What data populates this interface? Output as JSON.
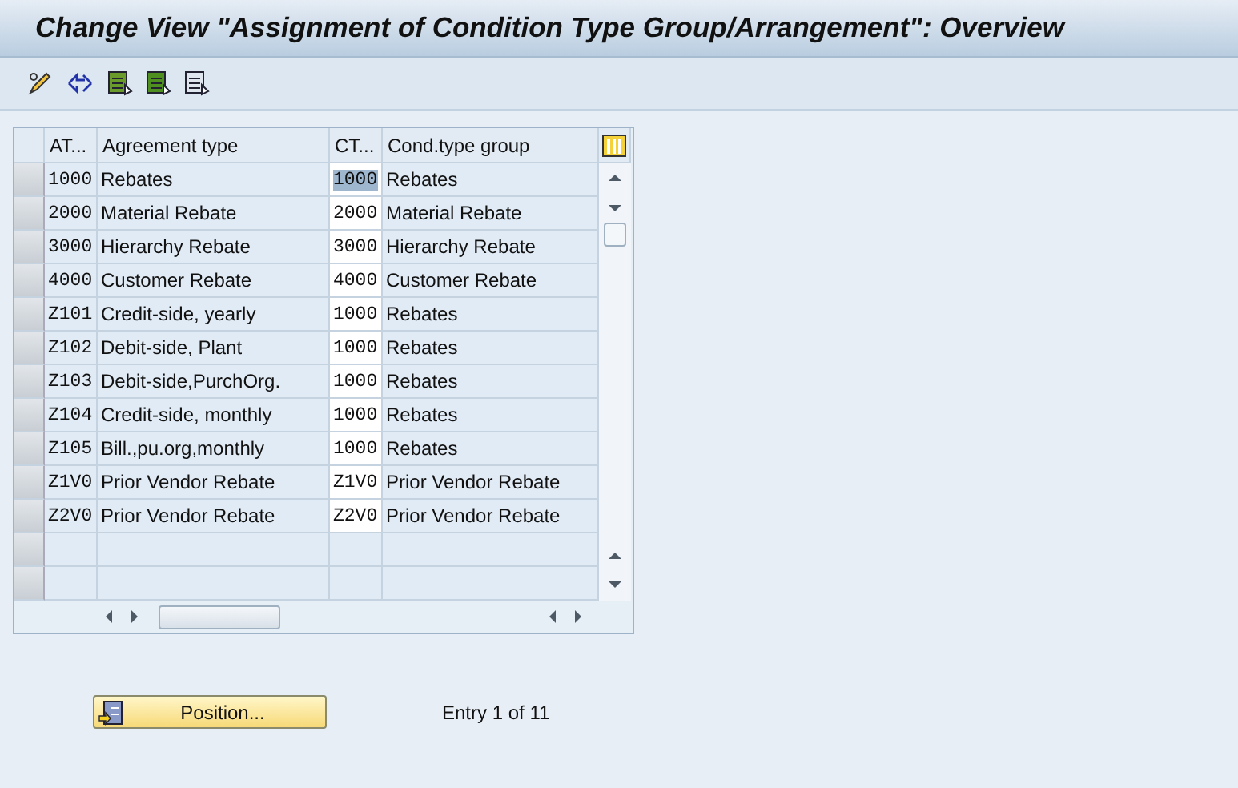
{
  "window": {
    "title": "Change View \"Assignment of Condition Type Group/Arrangement\": Overview"
  },
  "table": {
    "columns": [
      "AT...",
      "Agreement type",
      "CT...",
      "Cond.type group"
    ],
    "rows": [
      {
        "at": "1000",
        "agreement": "Rebates",
        "ct": "1000",
        "group": "Rebates",
        "highlighted": true
      },
      {
        "at": "2000",
        "agreement": "Material Rebate",
        "ct": "2000",
        "group": "Material Rebate",
        "highlighted": false
      },
      {
        "at": "3000",
        "agreement": "Hierarchy Rebate",
        "ct": "3000",
        "group": "Hierarchy Rebate",
        "highlighted": false
      },
      {
        "at": "4000",
        "agreement": "Customer Rebate",
        "ct": "4000",
        "group": "Customer Rebate",
        "highlighted": false
      },
      {
        "at": "Z101",
        "agreement": "Credit-side, yearly",
        "ct": "1000",
        "group": "Rebates",
        "highlighted": false
      },
      {
        "at": "Z102",
        "agreement": "Debit-side, Plant",
        "ct": "1000",
        "group": "Rebates",
        "highlighted": false
      },
      {
        "at": "Z103",
        "agreement": "Debit-side,PurchOrg.",
        "ct": "1000",
        "group": "Rebates",
        "highlighted": false
      },
      {
        "at": "Z104",
        "agreement": "Credit-side, monthly",
        "ct": "1000",
        "group": "Rebates",
        "highlighted": false
      },
      {
        "at": "Z105",
        "agreement": "Bill.,pu.org,monthly",
        "ct": "1000",
        "group": "Rebates",
        "highlighted": false
      },
      {
        "at": "Z1V0",
        "agreement": "Prior Vendor Rebate",
        "ct": "Z1V0",
        "group": "Prior Vendor Rebate",
        "highlighted": false
      },
      {
        "at": "Z2V0",
        "agreement": "Prior Vendor Rebate",
        "ct": "Z2V0",
        "group": "Prior Vendor Rebate",
        "highlighted": false
      }
    ]
  },
  "position_button": {
    "label": "Position..."
  },
  "entry_info": "Entry 1 of 11"
}
